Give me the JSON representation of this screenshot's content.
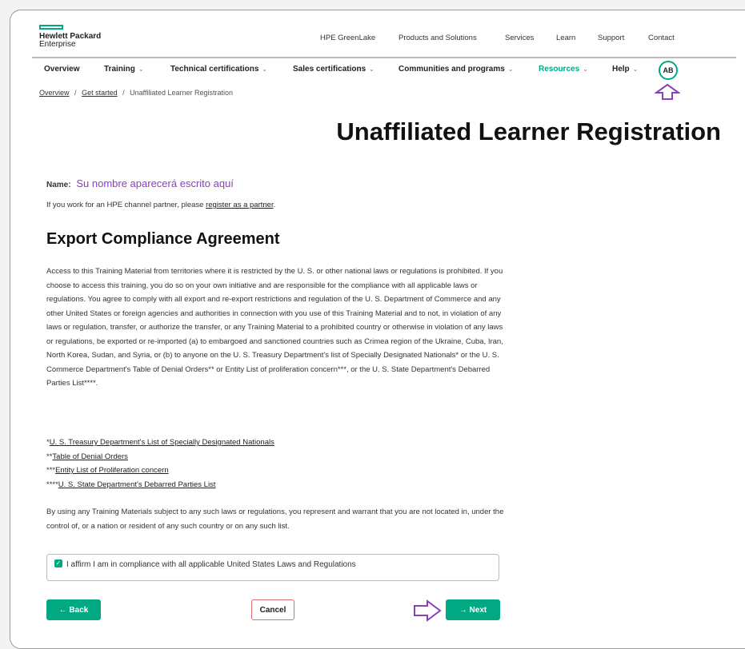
{
  "logo": {
    "line1": "Hewlett Packard",
    "line2": "Enterprise"
  },
  "top_links": [
    "HPE GreenLake",
    "Products and Solutions",
    "Services",
    "Learn",
    "Support",
    "Contact"
  ],
  "nav": [
    {
      "label": "Overview"
    },
    {
      "label": "Training"
    },
    {
      "label": "Technical certifications"
    },
    {
      "label": "Sales certifications"
    },
    {
      "label": "Communities and programs"
    },
    {
      "label": "Resources"
    },
    {
      "label": "Help"
    }
  ],
  "avatar": "AB",
  "breadcrumb": {
    "item1": "Overview",
    "sep": "/",
    "item2": "Get started",
    "current": "Unaffiliated Learner Registration"
  },
  "title": "Unaffiliated Learner Registration",
  "name": {
    "label": "Name:",
    "value": "Su nombre aparecerá escrito aquí"
  },
  "partner": {
    "text": "If you work for an HPE channel partner, please",
    "link": "register as a partner",
    "end": "."
  },
  "section_title": "Export Compliance Agreement",
  "paragraph1": "Access to this Training Material from territories where it is restricted by the U. S. or other national laws or regulations is prohibited. If you choose to access this training, you do so on your own initiative and are responsible for the compliance with all applicable laws or regulations. You agree to comply with all export and re-export restrictions and regulation of the U. S. Department of Commerce and any other United States or foreign agencies and authorities in connection with you use of this Training Material and to not, in violation of any laws or regulation, transfer, or authorize the transfer, or any Training Material to a prohibited country or otherwise in violation of any laws or regulations, be exported or re-imported (a) to embargoed and sanctioned countries such as Crimea region of the Ukraine, Cuba, Iran, North Korea, Sudan, and Syria, or (b) to anyone on the U. S. Treasury Department's list of Specially Designated Nationals* or the U. S. Commerce Department's Table of Denial Orders** or Entity List of proliferation concern***, or the U. S. State Department's Debarred Parties List****.",
  "ref_links": [
    {
      "prefix": "*",
      "text": "U. S. Treasury Department's List of Specially Designated Nationals"
    },
    {
      "prefix": "**",
      "text": "Table of Denial Orders"
    },
    {
      "prefix": "***",
      "text": "Entity List of Proliferation concern"
    },
    {
      "prefix": "****",
      "text": "U. S. State Department's Debarred Parties List"
    }
  ],
  "paragraph2": "By using any Training Materials subject to any such laws or regulations, you represent and warrant that you are not located in, under the control of, or a nation or resident of any such country or on any such list.",
  "affirm": {
    "checked": true,
    "check_glyph": "✓",
    "text": "I affirm I am in compliance with all applicable United States Laws and Regulations"
  },
  "buttons": {
    "back": "← Back",
    "cancel": "Cancel",
    "next": "→ Next"
  },
  "annotation_color": "#8a3fbf",
  "accent": "#01a982"
}
